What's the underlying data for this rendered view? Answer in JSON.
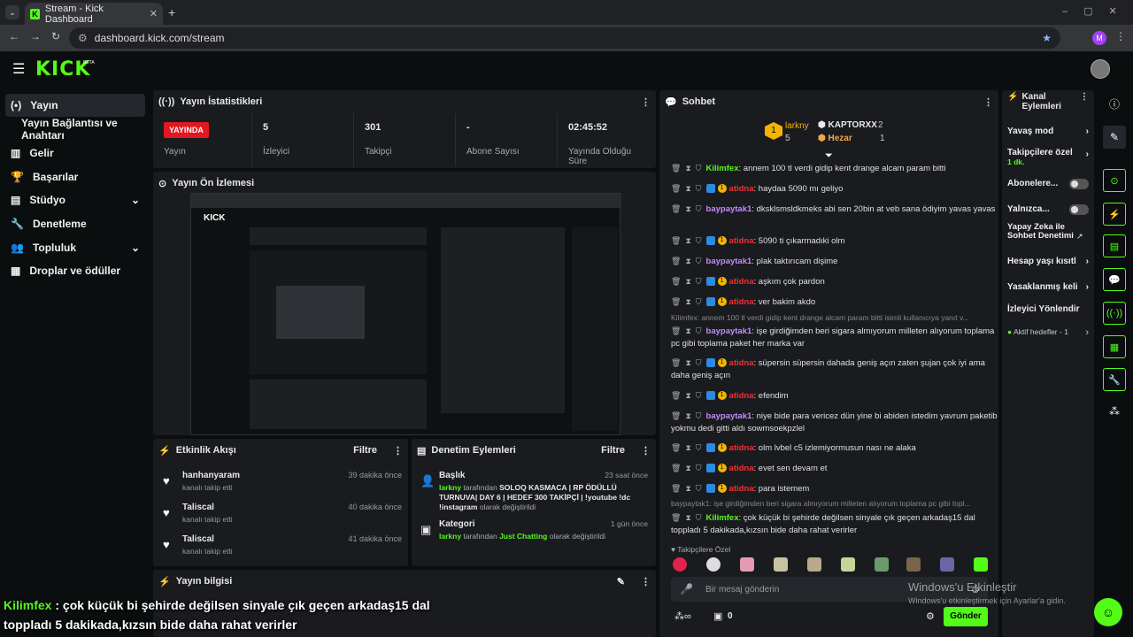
{
  "browser": {
    "tab_title": "Stream - Kick Dashboard",
    "url": "dashboard.kick.com/stream",
    "profile_initial": "M"
  },
  "brand": {
    "logo": "KICK",
    "beta": "BETA"
  },
  "sidebar": {
    "items": [
      {
        "label": "Yayın",
        "icon": "broadcast-icon"
      },
      {
        "label": "Yayın Bağlantısı ve Anahtarı",
        "icon": ""
      },
      {
        "label": "Gelir",
        "icon": "chart-icon"
      },
      {
        "label": "Başarılar",
        "icon": "trophy-icon"
      },
      {
        "label": "Stüdyo",
        "icon": "studio-icon"
      },
      {
        "label": "Denetleme",
        "icon": "wrench-icon"
      },
      {
        "label": "Topluluk",
        "icon": "people-icon"
      },
      {
        "label": "Droplar ve ödüller",
        "icon": "drops-icon"
      }
    ]
  },
  "stats": {
    "title": "Yayın İstatistikleri",
    "live": "YAYINDA",
    "live_label": "Yayın",
    "viewers": "5",
    "viewers_label": "İzleyici",
    "followers": "301",
    "followers_label": "Takipçi",
    "subs": "-",
    "subs_label": "Abone Sayısı",
    "duration": "02:45:52",
    "duration_label": "Yayında Olduğu Süre"
  },
  "preview": {
    "title": "Yayın Ön İzlemesi"
  },
  "activity": {
    "title": "Etkinlik Akışı",
    "filter": "Filtre",
    "items": [
      {
        "name": "hanhanyaram",
        "sub": "kanalı takip etti",
        "time": "39 dakika önce"
      },
      {
        "name": "Taliscal",
        "sub": "kanalı takip etti",
        "time": "40 dakika önce"
      },
      {
        "name": "Taliscal",
        "sub": "kanalı takip etti",
        "time": "41 dakika önce"
      }
    ]
  },
  "mod": {
    "title": "Denetim Eylemleri",
    "filter": "Filtre",
    "i1_title": "Başlık",
    "i1_time": "23 saat önce",
    "i1_user": "larkny",
    "i1_mid": " tarafından ",
    "i1_val": "SOLOQ KASMACA | RP ÖDÜLLÜ TURNUVA| DAY 6 | HEDEF 300 TAKİPÇİ | !youtube !dc !instagram",
    "i1_end": " olarak değiştirildi",
    "i2_title": "Kategori",
    "i2_time": "1 gün önce",
    "i2_user": "larkny",
    "i2_mid": " tarafından ",
    "i2_val": "Just Chatting",
    "i2_end": " olarak değiştirildi"
  },
  "info": {
    "title": "Yayın bilgisi"
  },
  "chat": {
    "title": "Sohbet",
    "lb1_name": "larkny",
    "lb1_val": "5",
    "lb2_name": "KAPTORXX",
    "lb2_val": "2",
    "lb3_name": "Hezar",
    "lb3_val": "1",
    "messages": [
      {
        "user": "Kilimfex",
        "cls": "nm-g",
        "text": "annem 100 tl verdi gidip kent drange alcam param bitti",
        "badge": false
      },
      {
        "user": "atidna",
        "cls": "nm-r",
        "text": "haydaa 5090 mı geliyo",
        "badge": true
      },
      {
        "user": "baypaytak1",
        "cls": "nm-p",
        "text": "dksklsmsldkmeks abi sen 20bin at veb sana ödiyim yavas yavas",
        "badge": false
      },
      {
        "user": "atidna",
        "cls": "nm-r",
        "text": "5090 ti çıkarmadıki olm",
        "badge": true
      },
      {
        "user": "baypaytak1",
        "cls": "nm-p",
        "text": "plak taktırıcam dişime",
        "badge": false
      },
      {
        "user": "atidna",
        "cls": "nm-r",
        "text": "aşkım çok pardon",
        "badge": true
      },
      {
        "user": "atidna",
        "cls": "nm-r",
        "text": "ver bakim akdo",
        "badge": true
      },
      {
        "user": "baypaytak1",
        "cls": "nm-p",
        "text": "işe girdiğimden beri sigara almıyorum milleten alıyorum toplama pc gibi toplama paket her marka var",
        "badge": false
      },
      {
        "user": "atidna",
        "cls": "nm-r",
        "text": "süpersin süpersin dahada geniş açın zaten şujan çok iyi ama daha geniş açın",
        "badge": true
      },
      {
        "user": "atidna",
        "cls": "nm-r",
        "text": "efendim",
        "badge": true
      },
      {
        "user": "baypaytak1",
        "cls": "nm-p",
        "text": "niye bide para vericez dün yine bi abiden istedim yavrum paketib yokmu dedi gitti aldı sowmsoekpzlel",
        "badge": false
      },
      {
        "user": "atidna",
        "cls": "nm-r",
        "text": "olm lvbel c5 izlemiyormusun nası ne alaka",
        "badge": true
      },
      {
        "user": "atidna",
        "cls": "nm-r",
        "text": "evet sen devam et",
        "badge": true
      },
      {
        "user": "atidna",
        "cls": "nm-r",
        "text": "para istemem",
        "badge": true
      },
      {
        "user": "Kilimfex",
        "cls": "nm-g",
        "text": "çok küçük bi şehirde değilsen sinyale çık geçen arkadaş15 dal toppladı 5 dakikada,kızsın bide daha rahat verirler",
        "badge": false
      }
    ],
    "reply1": "Kilimfex: annem 100 tl verdi gidip kent drange alcam param bitti isimli kullanıcıya yanıt v...",
    "reply2": "baypaytak1: işe girdiğimden beri sigara almıyorum milleten alıyorum toplama pc gibi topl...",
    "followers_only": "Takipçilere Özel",
    "placeholder": "Bir mesaj gönderin",
    "send": "Gönder",
    "count": "0"
  },
  "channel": {
    "title": "Kanal Eylemleri",
    "slow": "Yavaş mod",
    "fol": "Takipçilere özel",
    "fol_sub": "1 dk.",
    "subs": "Abonelere...",
    "only": "Yalnızca...",
    "ai": "Yapay Zeka ile Sohbet Denetimi",
    "age": "Hesap yaşı kısıtl",
    "banned": "Yasaklanmış keli",
    "redirect": "İzleyici Yönlendir",
    "goals": "Aktif hedefler - 1"
  },
  "windows": {
    "l1": "Windows'u Etkinleştir",
    "l2": "Windows'u etkinleştirmek için Ayarlar'a gidin."
  },
  "subtitle": {
    "name": "Kilimfex",
    "l1": " : çok küçük bi şehirde değilsen sinyale çık geçen arkadaş15 dal",
    "l2": "toppladı 5 dakikada,kızsın bide daha rahat verirler"
  },
  "colors": {
    "accent": "#53fc18",
    "live": "#e0181f",
    "panel": "#191b1f"
  }
}
